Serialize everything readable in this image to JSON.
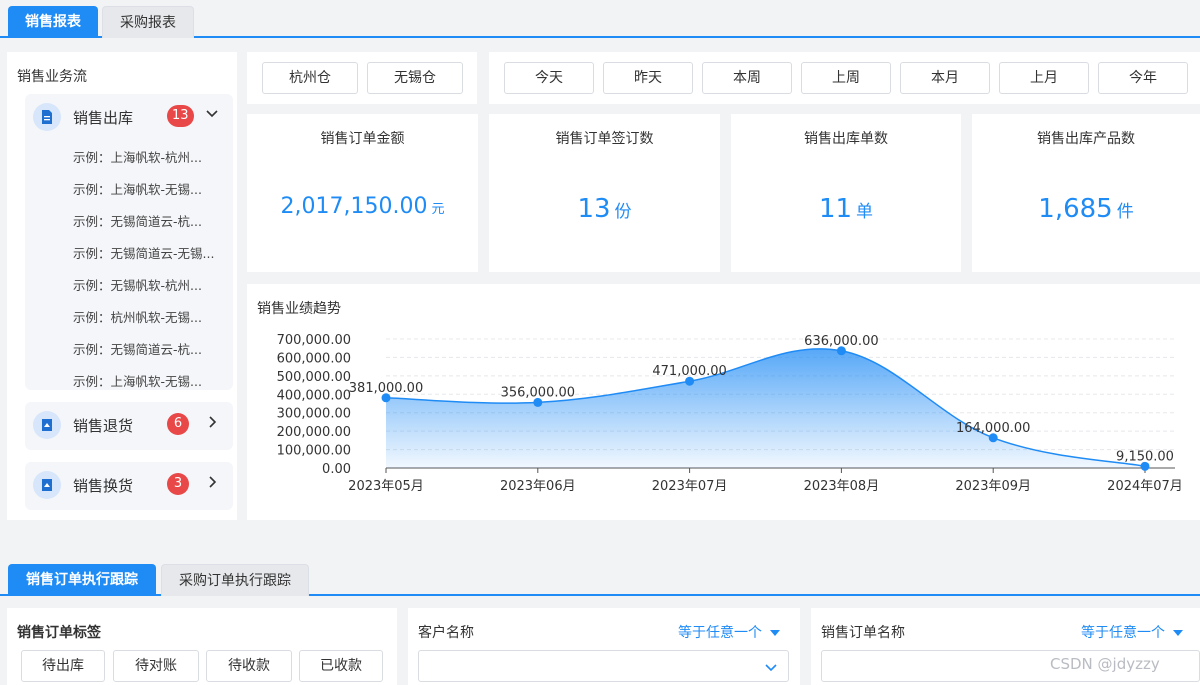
{
  "top_tabs": [
    {
      "label": "销售报表",
      "active": true
    },
    {
      "label": "采购报表",
      "active": false
    }
  ],
  "sidebar": {
    "title": "销售业务流",
    "groups": [
      {
        "label": "销售出库",
        "badge": "13",
        "expanded": true,
        "icon": "document-icon",
        "items": [
          "示例：上海帆软-杭州...",
          "示例：上海帆软-无锡...",
          "示例：无锡简道云-杭...",
          "示例：无锡简道云-无锡...",
          "示例：无锡帆软-杭州...",
          "示例：杭州帆软-无锡...",
          "示例：无锡简道云-杭...",
          "示例：上海帆软-无锡..."
        ]
      },
      {
        "label": "销售退货",
        "badge": "6",
        "expanded": false,
        "icon": "return-icon",
        "items": []
      },
      {
        "label": "销售换货",
        "badge": "3",
        "expanded": false,
        "icon": "exchange-icon",
        "items": []
      }
    ]
  },
  "warehouses": [
    "杭州仓",
    "无锡仓"
  ],
  "periods": [
    "今天",
    "昨天",
    "本周",
    "上周",
    "本月",
    "上月",
    "今年"
  ],
  "kpis": [
    {
      "title": "销售订单金额",
      "value": "2,017,150.00",
      "unit": "元"
    },
    {
      "title": "销售订单签订数",
      "value": "13",
      "unit": "份"
    },
    {
      "title": "销售出库单数",
      "value": "11",
      "unit": "单"
    },
    {
      "title": "销售出库产品数",
      "value": "1,685",
      "unit": "件"
    }
  ],
  "chart_title": "销售业绩趋势",
  "chart_data": {
    "type": "area",
    "categories": [
      "2023年05月",
      "2023年06月",
      "2023年07月",
      "2023年08月",
      "2023年09月",
      "2024年07月"
    ],
    "values": [
      381000,
      356000,
      471000,
      636000,
      164000,
      9150
    ],
    "value_labels": [
      "381,000.00",
      "356,000.00",
      "471,000.00",
      "636,000.00",
      "164,000.00",
      "9,150.00"
    ],
    "yticks": [
      "0.00",
      "100,000.00",
      "200,000.00",
      "300,000.00",
      "400,000.00",
      "500,000.00",
      "600,000.00",
      "700,000.00"
    ],
    "ylim": [
      0,
      700000
    ],
    "grid": true,
    "color": "#1f8bf5"
  },
  "bottom_tabs": [
    {
      "label": "销售订单执行跟踪",
      "active": true
    },
    {
      "label": "采购订单执行跟踪",
      "active": false
    }
  ],
  "tag_section": {
    "title": "销售订单标签",
    "tags": [
      "待出库",
      "待对账",
      "待收款",
      "已收款"
    ]
  },
  "filters": [
    {
      "label": "客户名称",
      "operator": "等于任意一个"
    },
    {
      "label": "销售订单名称",
      "operator": "等于任意一个"
    }
  ],
  "watermark": "CSDN @jdyzzy",
  "colors": {
    "accent": "#1f8bf5",
    "badge": "#e94848"
  }
}
